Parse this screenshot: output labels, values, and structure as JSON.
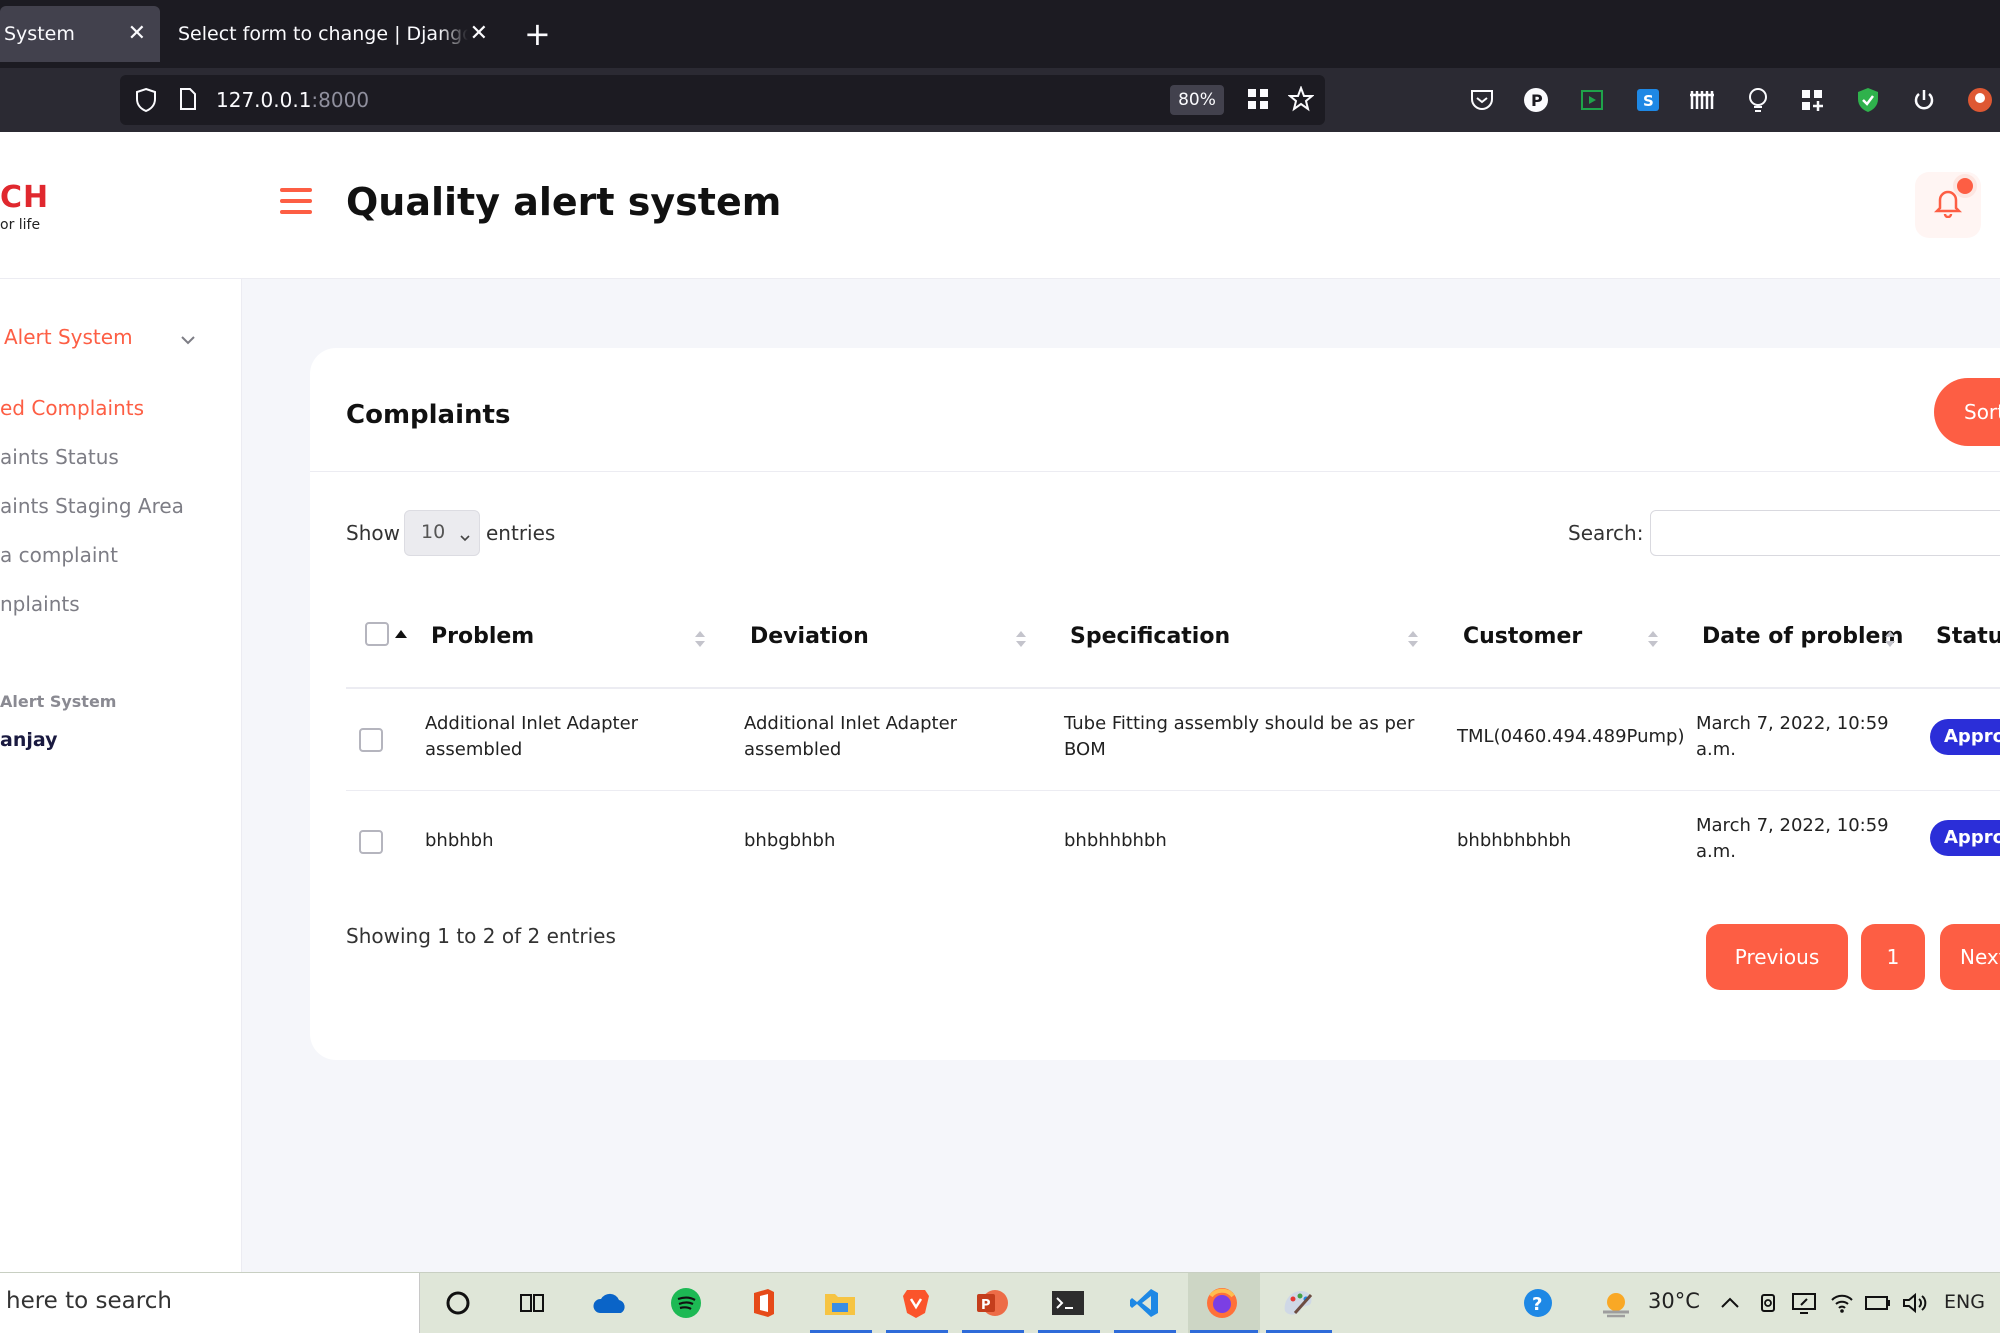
{
  "browser": {
    "tabs": [
      {
        "title": "System",
        "active": true
      },
      {
        "title": "Select form to change | Django site",
        "active": false
      }
    ],
    "url_host": "127.0.0.1",
    "url_port": ":8000",
    "zoom": "80%"
  },
  "header": {
    "logo_main": "CH",
    "logo_sub": "or life",
    "title": "Quality alert system"
  },
  "sidebar": {
    "group_label": "Alert System",
    "items": [
      {
        "label": "ed Complaints",
        "active": true
      },
      {
        "label": "aints Status",
        "active": false
      },
      {
        "label": "aints Staging Area",
        "active": false
      },
      {
        "label": " a complaint",
        "active": false
      },
      {
        "label": "nplaints",
        "active": false
      }
    ],
    "section_label": "Alert System",
    "user_name": "anjay"
  },
  "card": {
    "title": "Complaints",
    "sort_button": "Sort",
    "show_label": "Show",
    "page_length": "10",
    "entries_label": "entries",
    "search_label": "Search:",
    "search_value": "",
    "columns": [
      "Problem",
      "Deviation",
      "Specification",
      "Customer",
      "Date of problem",
      "Status"
    ],
    "rows": [
      {
        "problem": "Additional Inlet Adapter assembled",
        "deviation": "Additional Inlet Adapter assembled",
        "specification": "Tube Fitting assembly should be as per BOM",
        "customer": "TML(0460.494.489Pump)",
        "date": "March 7, 2022, 10:59 a.m.",
        "status": "Approved"
      },
      {
        "problem": "bhbhbh",
        "deviation": "bhbgbhbh",
        "specification": "bhbhhbhbh",
        "customer": "bhbhbhbhbh",
        "date": "March 7, 2022, 10:59 a.m.",
        "status": "Approved"
      }
    ],
    "info": "Showing 1 to 2 of 2 entries",
    "pagination": {
      "previous": "Previous",
      "current": "1",
      "next": "Next"
    }
  },
  "taskbar": {
    "search_placeholder": "here to search",
    "temperature": "30°C",
    "language": "ENG"
  },
  "colors": {
    "accent": "#fd5e44",
    "badge": "#2b2ed8",
    "browser_dark": "#1c1b22"
  }
}
